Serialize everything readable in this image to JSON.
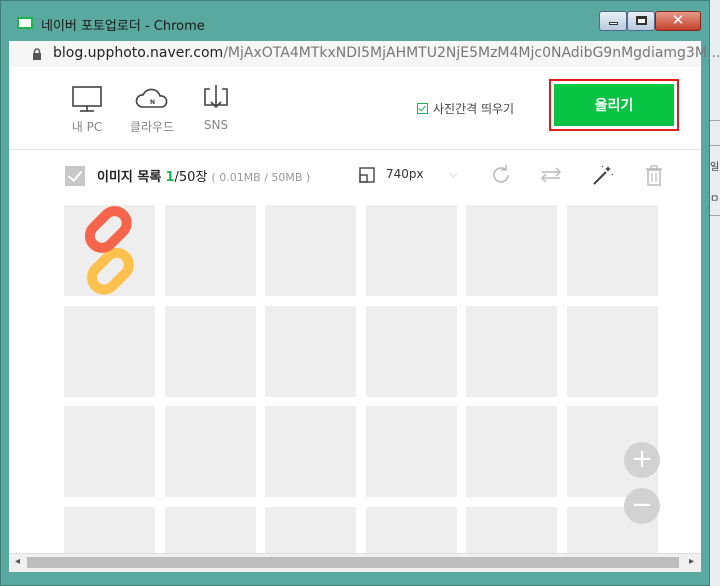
{
  "window": {
    "title": "네이버 포토업로더 - Chrome",
    "url_host": "blog.upphoto.naver.com",
    "url_path": "/MjAxOTA4MTkxNDI5MjAHMTU2NjE5MzM4Mjc0NAdibG9nMgdiamg3M..."
  },
  "sources": [
    {
      "label": "내 PC",
      "icon": "monitor-icon"
    },
    {
      "label": "클라우드",
      "icon": "cloud-icon"
    },
    {
      "label": "SNS",
      "icon": "download-icon"
    }
  ],
  "options": {
    "spacing_label": "사진간격 띄우기",
    "spacing_checked": true
  },
  "upload_button": "올리기",
  "list": {
    "title": "이미지 목록",
    "count": "1",
    "max": "/50장",
    "size_info": "( 0.01MB / 50MB )",
    "width_value": "740px"
  },
  "colors": {
    "accent": "#09c342",
    "highlight_border": "#e01b1b"
  },
  "page_behind": {
    "text_a": "일",
    "text_b": "ㅁ"
  }
}
